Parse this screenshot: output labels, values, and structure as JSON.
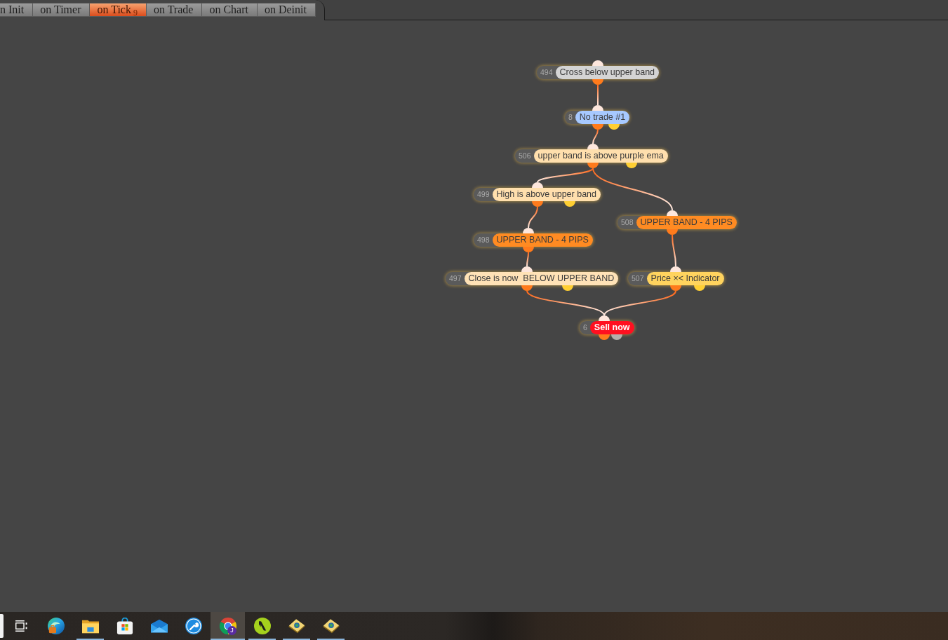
{
  "tabs": [
    {
      "label": "n Init",
      "selected": false
    },
    {
      "label": "on Timer",
      "selected": false
    },
    {
      "label": "on Tick",
      "selected": true,
      "count": "9"
    },
    {
      "label": "on Trade",
      "selected": false
    },
    {
      "label": "on Chart",
      "selected": false
    },
    {
      "label": "on Deinit",
      "selected": false
    }
  ],
  "nodes": [
    {
      "number": "494",
      "label": "Cross below upper band",
      "kind": "condition",
      "color": "#d4d4d4",
      "outputs": [
        {
          "color": "#ff7b1c"
        }
      ]
    },
    {
      "number": "8",
      "label": "No trade #1",
      "kind": "condition",
      "color": "#a7c9ff",
      "outputs": [
        {
          "color": "#ff7b1c"
        },
        {
          "color": "#ffcf33"
        }
      ]
    },
    {
      "number": "506",
      "label": "upper band is above purple ema",
      "kind": "condition",
      "color": "#ffdfad",
      "outputs": [
        {
          "color": "#ff7b1c"
        },
        {
          "color": "#ffcf33"
        }
      ]
    },
    {
      "number": "499",
      "label": "High is above upper band",
      "kind": "condition",
      "color": "#ffdfad",
      "outputs": [
        {
          "color": "#ff7b1c"
        },
        {
          "color": "#ffcf33"
        }
      ]
    },
    {
      "number": "508",
      "label": "UPPER BAND - 4 PIPS",
      "kind": "condition",
      "color": "#ff8b22",
      "outputs": [
        {
          "color": "#ff7b1c"
        }
      ]
    },
    {
      "number": "498",
      "label": "UPPER BAND - 4 PIPS",
      "kind": "condition",
      "color": "#ff8b22",
      "outputs": [
        {
          "color": "#ff7b1c"
        }
      ]
    },
    {
      "number": "497",
      "label": "Close is now  BELOW UPPER BAND",
      "kind": "condition",
      "color": "#ffe2b6",
      "outputs": [
        {
          "color": "#ff7b1c"
        },
        {
          "color": "#ffcf33"
        }
      ]
    },
    {
      "number": "507",
      "label": "Price ×< Indicator",
      "kind": "condition",
      "color": "#ffd35e",
      "outputs": [
        {
          "color": "#ff7b1c"
        },
        {
          "color": "#ffcf33"
        }
      ]
    },
    {
      "number": "6",
      "label": "Sell now",
      "kind": "action",
      "color": "#ff1020",
      "outputs": [
        {
          "color": "#ff7b1c"
        },
        {
          "color": "#b4b0ab"
        }
      ]
    }
  ],
  "taskbar": {
    "apps": [
      {
        "running": false,
        "selected": false
      },
      {
        "running": true,
        "selected": false
      },
      {
        "running": false,
        "selected": false
      },
      {
        "running": false,
        "selected": false
      },
      {
        "running": false,
        "selected": false
      },
      {
        "running": true,
        "selected": true,
        "badge": "J"
      },
      {
        "running": true,
        "selected": false
      },
      {
        "running": true,
        "selected": false
      },
      {
        "running": true,
        "selected": false
      }
    ]
  }
}
